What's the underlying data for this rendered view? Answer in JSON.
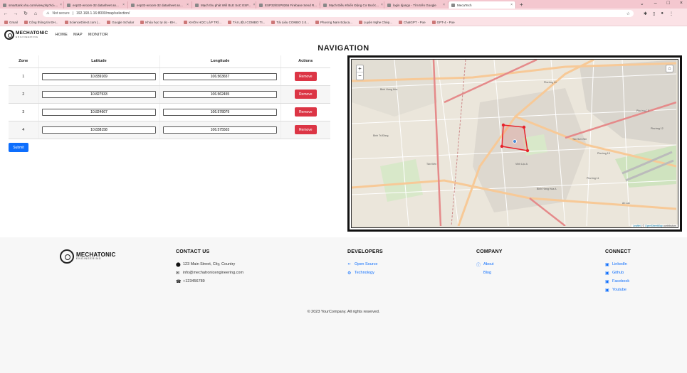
{
  "browser": {
    "tabs": [
      {
        "label": "smarttank.vhu.com/view.php?id=..."
      },
      {
        "label": "esp32-wroom-32 datasheet an..."
      },
      {
        "label": "esp32-wroom-32 datasheet an..."
      },
      {
        "label": "Mạch thu phát Wifi BLE SoC ESP..."
      },
      {
        "label": "ESP32/ESP8266 Firebase Send R..."
      },
      {
        "label": "Mạch Điều Khiển Động Cơ Bước..."
      },
      {
        "label": "login django - Tìm trên Google"
      },
      {
        "label": "MecaTech",
        "active": true
      }
    ],
    "url": "192.168.1.16:8000/map/selection/",
    "security_label": "Not secure",
    "bookmarks": [
      "Gmail",
      "Công thông tin ĐH...",
      "ScienceDirect.com |...",
      "Google Scholar",
      "Khóa học tự do - ĐH...",
      "KHÓA HỌC LẬP TRÌ...",
      "TÀI LIỆU COMBO TI...",
      "Tài Liệu COMBO 2.0...",
      "Phương Nam Educa...",
      "Luyện Nghe Chép...",
      "ChatGPT - Poe",
      "GPT-4 - Poe"
    ]
  },
  "header": {
    "brand": "MECHATONIC",
    "brand_sub": "ENGINEERING",
    "nav": [
      "HOME",
      "MAP",
      "MONITOR"
    ]
  },
  "page_title": "NAVIGATION",
  "table": {
    "headers": [
      "Zone",
      "Latitude",
      "Longitude",
      "Actions"
    ],
    "rows": [
      {
        "zone": "1",
        "lat": "10.839169",
        "lng": "106.563657",
        "action": "Remove"
      },
      {
        "zone": "2",
        "lat": "10.827533",
        "lng": "106.562455",
        "action": "Remove"
      },
      {
        "zone": "3",
        "lat": "10.824667",
        "lng": "106.578079",
        "action": "Remove"
      },
      {
        "zone": "4",
        "lat": "10.838158",
        "lng": "106.575503",
        "action": "Remove"
      }
    ],
    "submit_label": "Submit"
  },
  "map": {
    "zoom_in": "+",
    "zoom_out": "−",
    "home": "⌂",
    "attribution_leaflet": "Leaflet",
    "attribution_osm": "OpenStreetMap",
    "attribution_rest": "contributors",
    "labels": {
      "l1": "Bình Hưng Hòa",
      "l2": "Phường 13",
      "l3": "Phường 12",
      "l4": "Tân Sơn Nhì",
      "l5": "Bình Trị Đông",
      "l6": "Phường 15",
      "l7": "Vĩnh Lộc A",
      "l8": "Tân Kiên",
      "l9": "Bình Hưng Hòa A",
      "l10": "Phường 11",
      "l11": "An Lạc",
      "l12": "Phường 14"
    },
    "colors": {
      "polygon": "#e8212a",
      "road_major": "#f7c997",
      "road_trunk": "#e58a8a",
      "land": "#ebe6db",
      "green": "#cfe3bf"
    }
  },
  "footer": {
    "brand": "MECHATONIC",
    "brand_sub": "ENGINEERING",
    "contact": {
      "title": "CONTACT US",
      "address": "123 Main Street, City, Country",
      "email": "info@mechatronicengineering.com",
      "phone": "+123456789"
    },
    "developers": {
      "title": "DEVELOPERS",
      "items": [
        "Open Source",
        "Technology"
      ]
    },
    "company": {
      "title": "COMPANY",
      "items": [
        "About",
        "Blog"
      ]
    },
    "connect": {
      "title": "CONNECT",
      "items": [
        "LinkedIn",
        "Github",
        "Facebook",
        "Youtube"
      ]
    },
    "copyright": "© 2023 YourCompany. All rights reserved."
  }
}
